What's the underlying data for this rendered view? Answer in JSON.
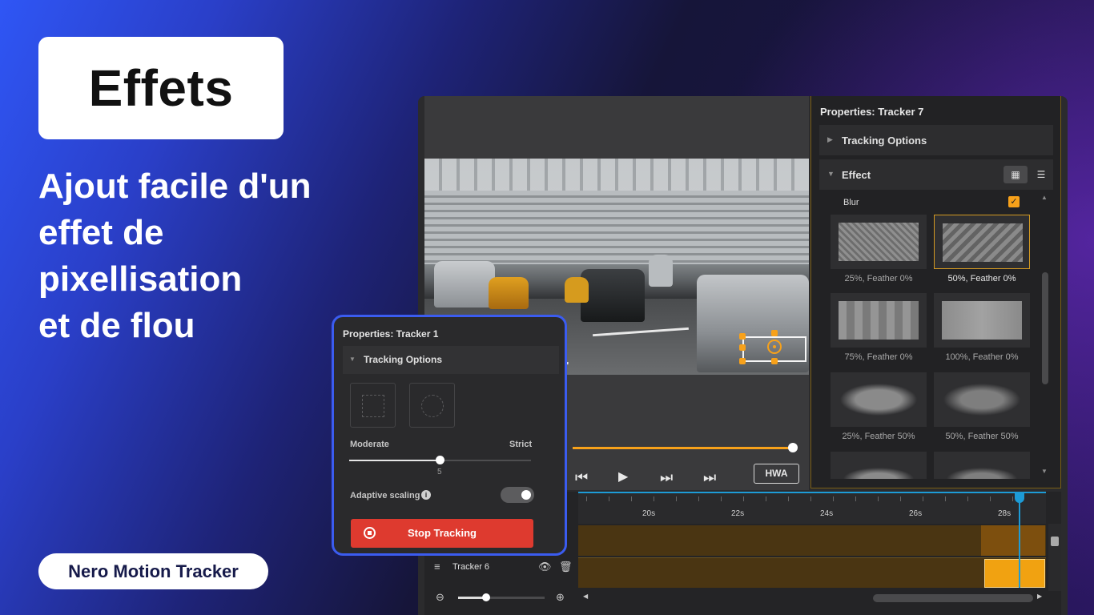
{
  "hero": {
    "badge": "Effets",
    "headline": [
      "Ajout facile d'un",
      "effet de",
      "pixellisation",
      "et de flou"
    ],
    "brand": "Nero Motion Tracker"
  },
  "app": {
    "transport": {
      "prev_frame_icon": "step-back-icon",
      "play_icon": "play-icon",
      "next_frame_icon": "step-forward-icon",
      "end_icon": "skip-end-icon",
      "hwa_label": "HWA"
    },
    "properties": {
      "title": "Properties: Tracker 7",
      "tracking_options_label": "Tracking Options",
      "effect_label": "Effect",
      "blur_label": "Blur",
      "blur_checked": true,
      "presets": [
        {
          "caption": "25%, Feather 0%",
          "selected": false
        },
        {
          "caption": "50%, Feather 0%",
          "selected": true
        },
        {
          "caption": "75%, Feather 0%",
          "selected": false
        },
        {
          "caption": "100%, Feather 0%",
          "selected": false
        },
        {
          "caption": "25%, Feather 50%",
          "selected": false
        },
        {
          "caption": "50%, Feather 50%",
          "selected": false
        }
      ]
    },
    "timeline": {
      "ticks": [
        "20s",
        "22s",
        "24s",
        "26s",
        "28s"
      ],
      "track_name": "Tracker 6"
    }
  },
  "floating": {
    "title": "Properties: Tracker 1",
    "tracking_options_label": "Tracking Options",
    "moderate_label": "Moderate",
    "strict_label": "Strict",
    "slider_value": "5",
    "adaptive_label": "Adaptive scaling",
    "adaptive_on": true,
    "stop_label": "Stop Tracking"
  },
  "colors": {
    "accent": "#f7a11a",
    "stop_button": "#de3a2f",
    "card_border": "#3b5cf0",
    "playhead": "#1d9bd6"
  }
}
